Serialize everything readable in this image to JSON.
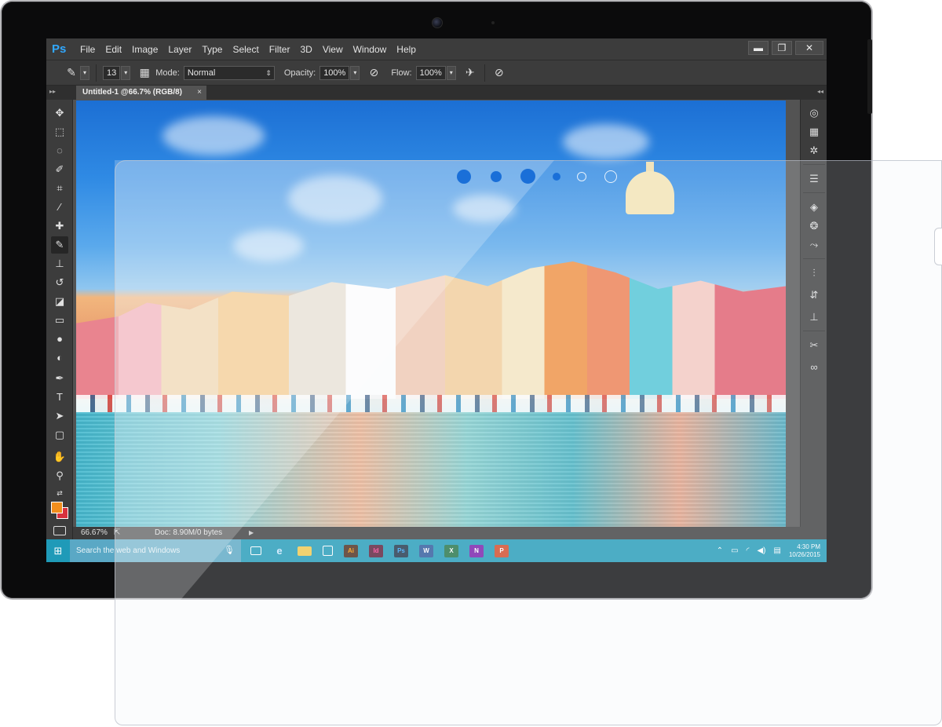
{
  "photoshop": {
    "logo": "Ps",
    "menu": [
      "File",
      "Edit",
      "Image",
      "Layer",
      "Type",
      "Select",
      "Filter",
      "3D",
      "View",
      "Window",
      "Help"
    ],
    "window_controls": {
      "minimize": "▬",
      "restore": "❐",
      "close": "✕"
    },
    "options": {
      "brush_size": "13",
      "mode_label": "Mode:",
      "mode_value": "Normal",
      "opacity_label": "Opacity:",
      "opacity_value": "100%",
      "flow_label": "Flow:",
      "flow_value": "100%"
    },
    "document_tab": {
      "title": "Untitled-1 @66.7% (RGB/8)",
      "close": "×"
    },
    "status": {
      "zoom": "66.67%",
      "doc_info": "Doc: 8.90M/0 bytes"
    },
    "colors": {
      "foreground": "#f18e1d",
      "background": "#d8323e"
    },
    "tools": [
      "move-tool-icon",
      "marquee-tool-icon",
      "lasso-tool-icon",
      "quick-selection-tool-icon",
      "crop-tool-icon",
      "eyedropper-tool-icon",
      "healing-brush-tool-icon",
      "brush-tool-icon",
      "clone-stamp-tool-icon",
      "history-brush-tool-icon",
      "eraser-tool-icon",
      "gradient-tool-icon",
      "blur-tool-icon",
      "dodge-tool-icon",
      "pen-tool-icon",
      "type-tool-icon",
      "path-selection-tool-icon",
      "rectangle-tool-icon",
      "hand-tool-icon",
      "zoom-tool-icon"
    ],
    "dock_icons": [
      "3d-panel-icon",
      "swatches-panel-icon",
      "adjustments-panel-icon",
      "properties-panel-icon",
      "layers-panel-icon",
      "channels-panel-icon",
      "paths-panel-icon",
      "brush-panel-icon",
      "history-panel-icon",
      "clone-source-panel-icon",
      "tool-presets-panel-icon",
      "creative-cloud-icon"
    ]
  },
  "taskbar": {
    "search_placeholder": "Search the web and Windows",
    "apps": [
      {
        "name": "task-view",
        "label": "",
        "color": "#1f9ab8"
      },
      {
        "name": "edge",
        "label": "e",
        "color": "#1f9ab8"
      },
      {
        "name": "file-explorer",
        "label": "",
        "color": "#f2c94c"
      },
      {
        "name": "store",
        "label": "",
        "color": "#1f9ab8"
      },
      {
        "name": "illustrator",
        "label": "Ai",
        "color": "#4a2a1a"
      },
      {
        "name": "indesign",
        "label": "Id",
        "color": "#5a1a36"
      },
      {
        "name": "photoshop",
        "label": "Ps",
        "color": "#1b3247"
      },
      {
        "name": "word",
        "label": "W",
        "color": "#2b579a"
      },
      {
        "name": "excel",
        "label": "X",
        "color": "#217346"
      },
      {
        "name": "onenote",
        "label": "N",
        "color": "#7719aa"
      },
      {
        "name": "powerpoint",
        "label": "P",
        "color": "#d24726"
      }
    ],
    "time": "4:30 PM",
    "date": "10/26/2015"
  }
}
